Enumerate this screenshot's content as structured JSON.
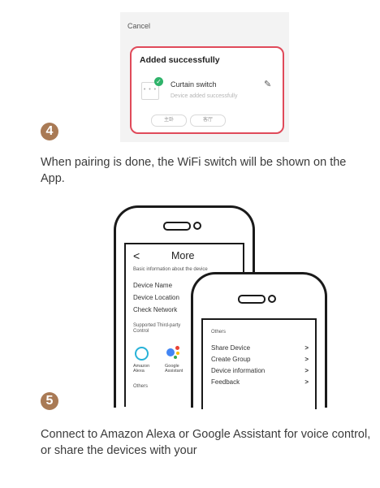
{
  "step4": {
    "number": "4",
    "app": {
      "cancel_label": "Cancel",
      "title": "Added successfully",
      "device_name": "Curtain switch",
      "device_status": "Device added successfully",
      "rooms": [
        "主卧",
        "客厅"
      ]
    },
    "caption": "When pairing is done, the WiFi switch will be shown on the App."
  },
  "phone_more": {
    "title": "More",
    "section_label": "Basic information about the device",
    "items": [
      "Device Name",
      "Device Location",
      "Check Network"
    ],
    "third_party_label": "Supported Third-party Control",
    "assistants": [
      "Amazon Alexa",
      "Google Assistant"
    ],
    "others_label": "Others"
  },
  "phone_others": {
    "section_label": "Others",
    "items": [
      {
        "label": "Share Device",
        "chevron": ">"
      },
      {
        "label": "Create Group",
        "chevron": ">"
      },
      {
        "label": "Device information",
        "chevron": ">"
      },
      {
        "label": "Feedback",
        "chevron": ">"
      }
    ]
  },
  "step5": {
    "number": "5",
    "caption": "Connect to Amazon Alexa or Google Assistant for voice control, or share the devices with your"
  },
  "colors": {
    "accent_step": "#a97a55",
    "highlight_border": "#e04a5a",
    "success_check": "#2fb36a",
    "alexa": "#28b2d8"
  }
}
